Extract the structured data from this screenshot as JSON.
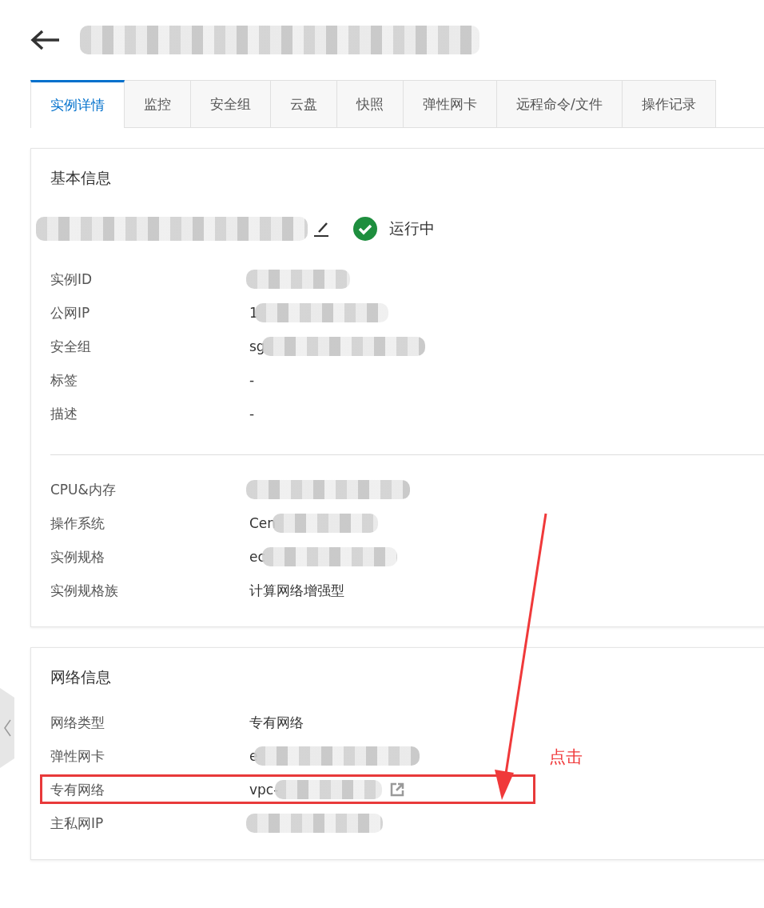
{
  "header": {
    "title": {
      "redacted": true
    }
  },
  "tabs": [
    {
      "label": "实例详情",
      "selected": true
    },
    {
      "label": "监控",
      "selected": false
    },
    {
      "label": "安全组",
      "selected": false
    },
    {
      "label": "云盘",
      "selected": false
    },
    {
      "label": "快照",
      "selected": false
    },
    {
      "label": "弹性网卡",
      "selected": false
    },
    {
      "label": "远程命令/文件",
      "selected": false
    },
    {
      "label": "操作记录",
      "selected": false
    }
  ],
  "basic_info": {
    "title": "基本信息",
    "instance_name": {
      "redacted": true
    },
    "status": "运行中",
    "groups": [
      [
        {
          "label": "实例ID",
          "redacted": true
        },
        {
          "label": "公网IP",
          "value": "1",
          "redacted": true
        },
        {
          "label": "安全组",
          "value": "sg",
          "redacted": true
        },
        {
          "label": "标签",
          "value": "-",
          "redacted": false
        },
        {
          "label": "描述",
          "value": "-",
          "redacted": false
        }
      ],
      [
        {
          "label": "CPU&内存",
          "redacted": true
        },
        {
          "label": "操作系统",
          "value": "Cen",
          "redacted": true
        },
        {
          "label": "实例规格",
          "value": "ec",
          "redacted": true
        },
        {
          "label": "实例规格族",
          "value": "计算网络增强型",
          "redacted": false
        }
      ]
    ]
  },
  "network_info": {
    "title": "网络信息",
    "rows": [
      {
        "label": "网络类型",
        "value": "专有网络",
        "redacted": false,
        "kind": "text",
        "highlighted": false
      },
      {
        "label": "弹性网卡",
        "value": "e",
        "redacted": true,
        "kind": "text",
        "highlighted": false
      },
      {
        "label": "专有网络",
        "value": "vpc-",
        "redacted": true,
        "kind": "link",
        "highlighted": true
      },
      {
        "label": "主私网IP",
        "redacted": true,
        "kind": "text",
        "highlighted": false
      }
    ]
  },
  "annotation": {
    "label": "点击"
  }
}
